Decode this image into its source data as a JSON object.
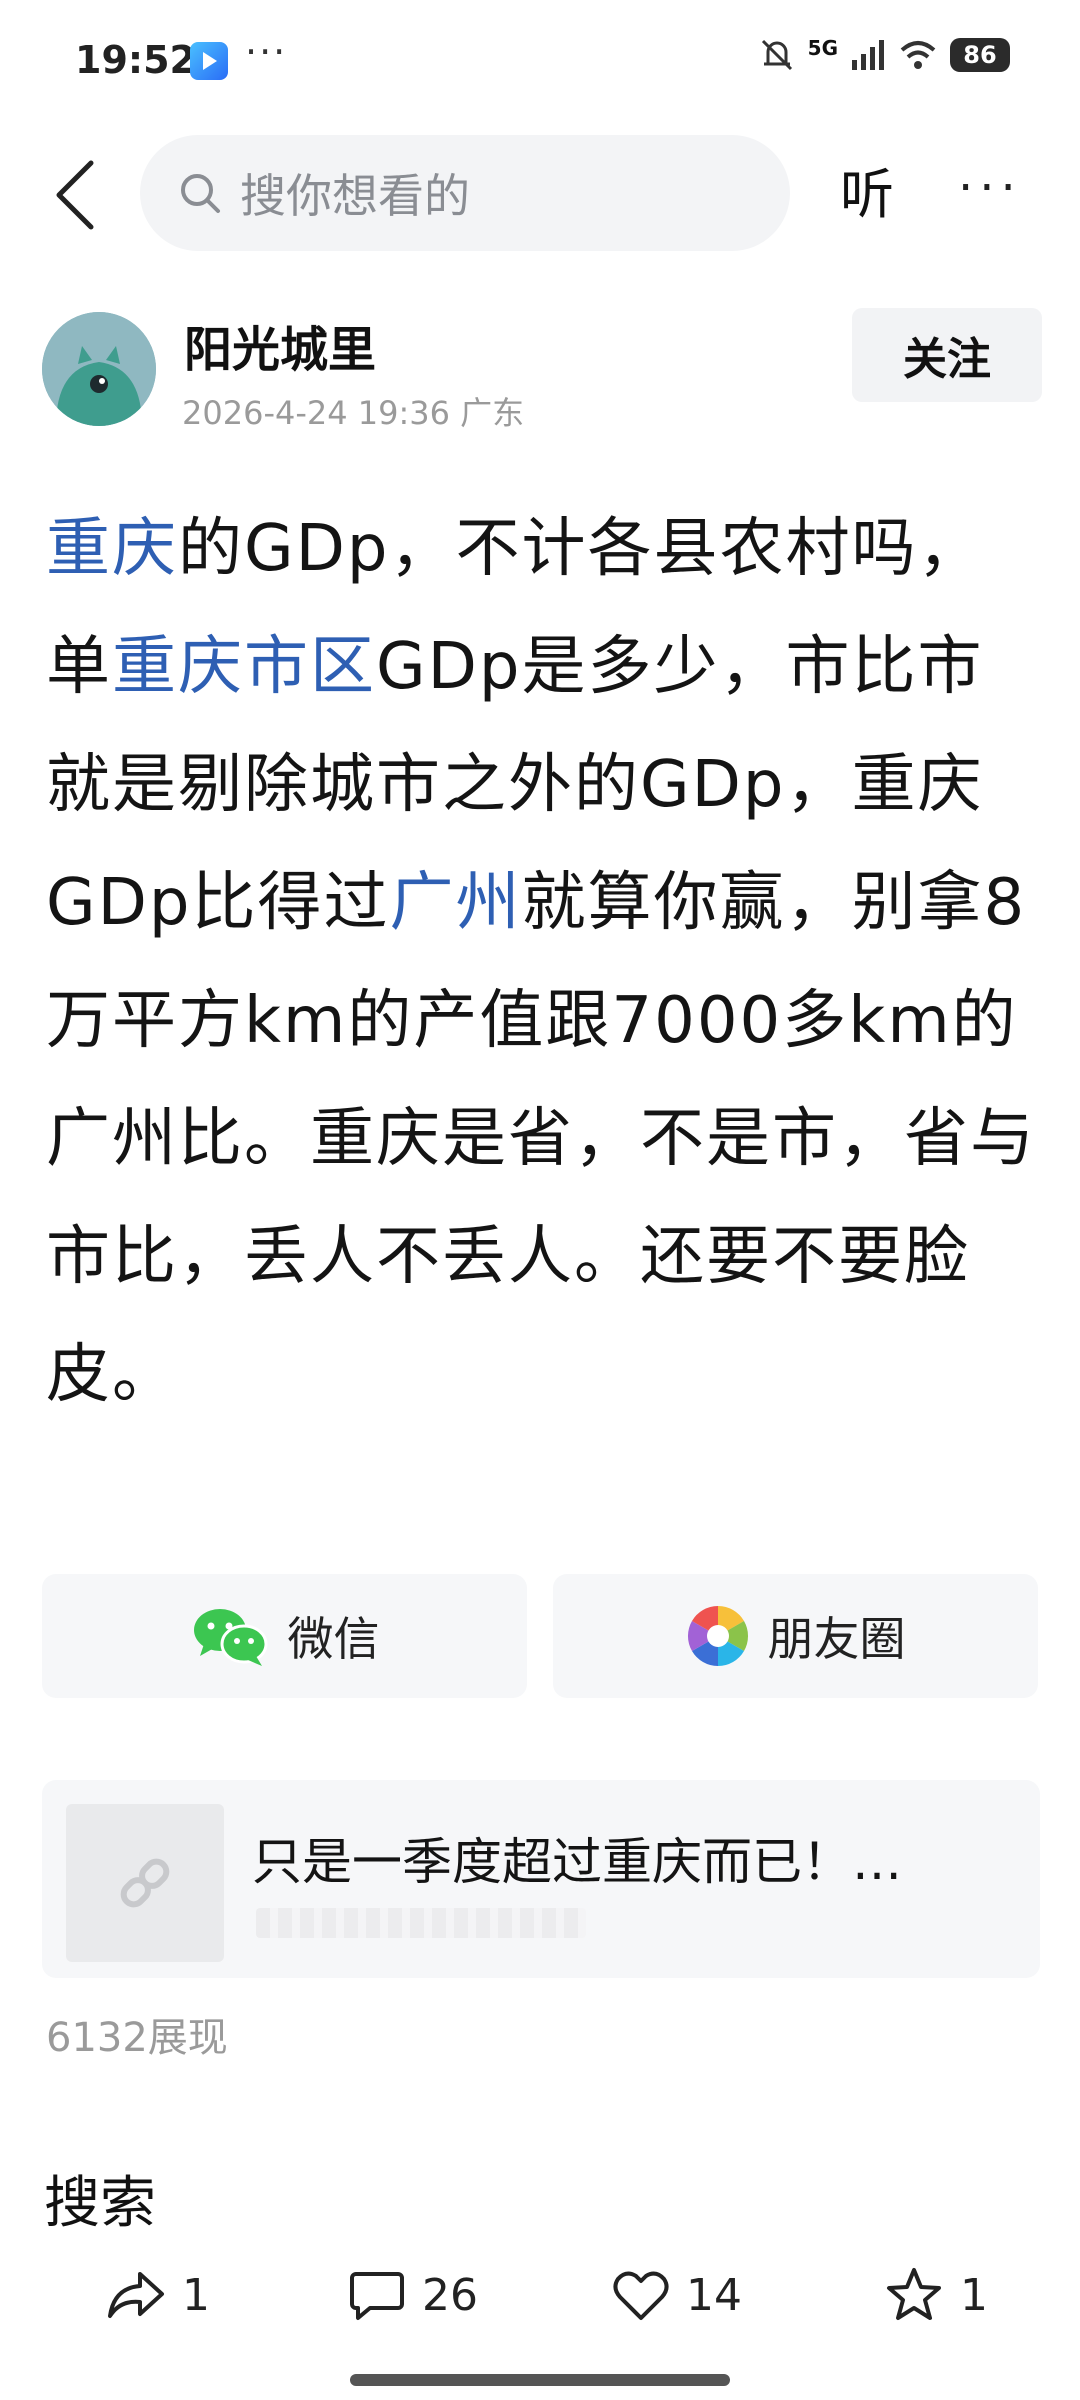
{
  "status_bar": {
    "time": "19:52",
    "dots": "···",
    "network": "5G",
    "battery": "86",
    "icons": [
      "app-video-icon",
      "mute-icon",
      "signal-icon",
      "wifi-icon",
      "battery-icon"
    ]
  },
  "nav": {
    "search_placeholder": "搜你想看的",
    "listen_label": "听",
    "more_label": "···"
  },
  "author": {
    "name": "阳光城里",
    "meta": "2026-4-24 19:36 广东",
    "follow_label": "关注"
  },
  "post": {
    "segments": [
      {
        "text": "重庆",
        "link": true
      },
      {
        "text": "的GDp，不计各县农村吗，单",
        "link": false
      },
      {
        "text": "重庆市区",
        "link": true
      },
      {
        "text": "GDp是多少，市比市就是剔除城市之外的GDp，重庆GDp比得过",
        "link": false
      },
      {
        "text": "广州",
        "link": true
      },
      {
        "text": "就算你赢，别拿8万平方km的产值跟7000多km的广州比。重庆是省，不是市，省与市比，丢人不丢人。还要不要脸皮。",
        "link": false
      }
    ]
  },
  "share": {
    "wechat_label": "微信",
    "moments_label": "朋友圈"
  },
  "link_card": {
    "title": "只是一季度超过重庆而已！…"
  },
  "views": "6132展现",
  "search_section": "搜索",
  "actions": {
    "share_count": "1",
    "comment_count": "26",
    "like_count": "14",
    "star_count": "1"
  },
  "colors": {
    "link": "#2e5fb3",
    "wechat_green": "#3cc651"
  }
}
